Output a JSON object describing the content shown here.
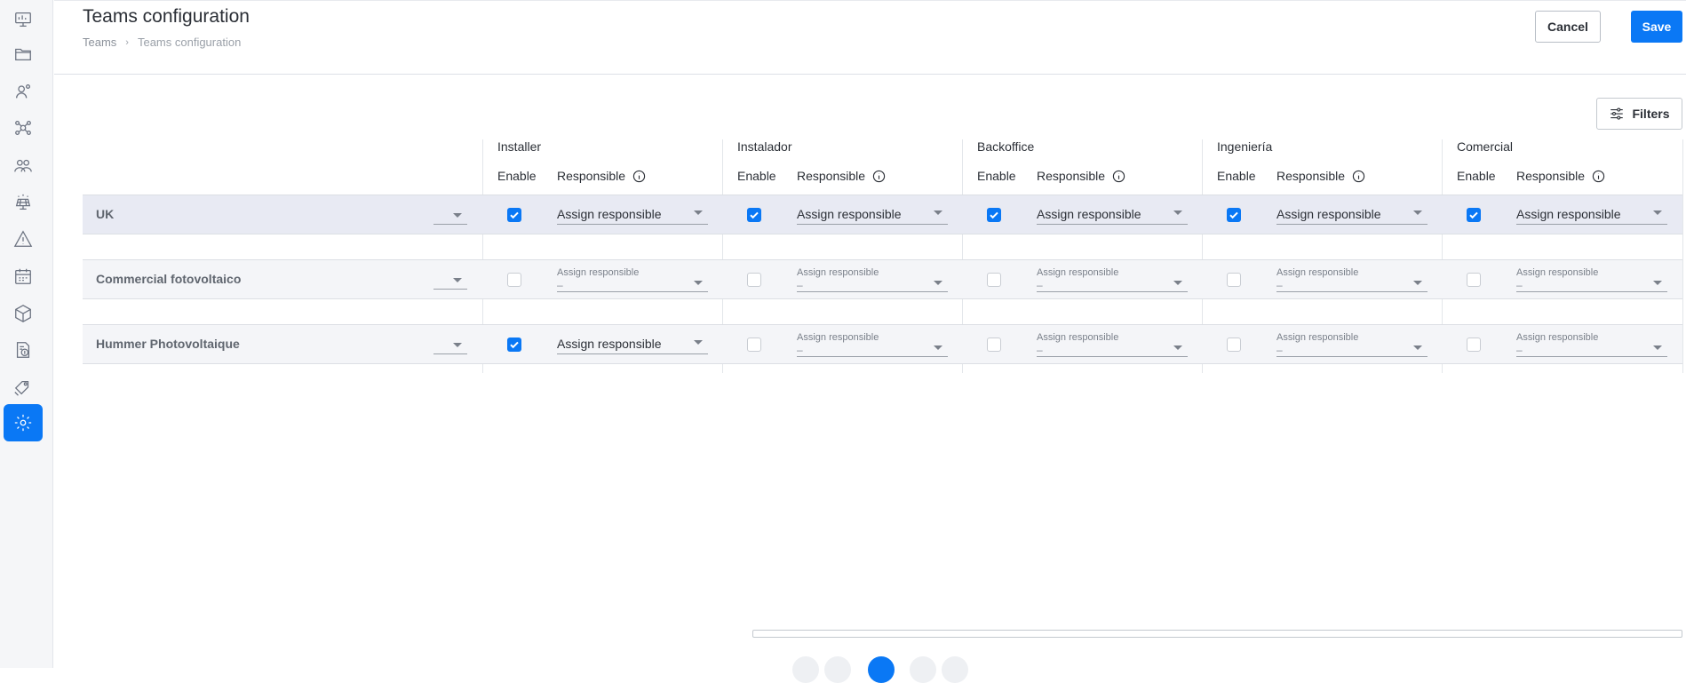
{
  "sidebar": {
    "items": [
      {
        "icon": "monitor-dashboard-icon",
        "active": false
      },
      {
        "icon": "folder-icon",
        "active": false
      },
      {
        "icon": "user-connect-icon",
        "active": false
      },
      {
        "icon": "team-network-icon",
        "active": false
      },
      {
        "icon": "users-group-icon",
        "active": false
      },
      {
        "icon": "solar-panel-icon",
        "active": false
      },
      {
        "icon": "warning-triangle-icon",
        "active": false
      },
      {
        "icon": "calendar-icon",
        "active": false
      },
      {
        "icon": "box-icon",
        "active": false
      },
      {
        "icon": "invoice-dollar-icon",
        "active": false
      },
      {
        "icon": "tag-discount-icon",
        "active": false
      },
      {
        "icon": "settings-gear-icon",
        "active": true
      }
    ]
  },
  "header": {
    "title": "Teams configuration",
    "breadcrumb": {
      "root": "Teams",
      "separator": "›",
      "current": "Teams configuration"
    },
    "cancel_label": "Cancel",
    "save_label": "Save"
  },
  "toolbar": {
    "filters_label": "Filters"
  },
  "columns": {
    "enable_label": "Enable",
    "responsible_label": "Responsible",
    "groups": [
      "Installer",
      "Instalador",
      "Backoffice",
      "Ingeniería",
      "Comercial"
    ]
  },
  "rows": [
    {
      "name": "UK",
      "cells": [
        {
          "enabled": true,
          "value": "Assign responsible"
        },
        {
          "enabled": true,
          "value": "Assign responsible"
        },
        {
          "enabled": true,
          "value": "Assign responsible"
        },
        {
          "enabled": true,
          "value": "Assign responsible"
        },
        {
          "enabled": true,
          "value": "Assign responsible"
        }
      ]
    },
    {
      "name": "Commercial fotovoltaico",
      "cells": [
        {
          "enabled": false,
          "placeholder": "Assign responsible",
          "value": "–"
        },
        {
          "enabled": false,
          "placeholder": "Assign responsible",
          "value": "–"
        },
        {
          "enabled": false,
          "placeholder": "Assign responsible",
          "value": "–"
        },
        {
          "enabled": false,
          "placeholder": "Assign responsible",
          "value": "–"
        },
        {
          "enabled": false,
          "placeholder": "Assign responsible",
          "value": "–"
        }
      ]
    },
    {
      "name": "Hummer Photovoltaique",
      "cells": [
        {
          "enabled": true,
          "value": "Assign responsible"
        },
        {
          "enabled": false,
          "placeholder": "Assign responsible",
          "value": "–"
        },
        {
          "enabled": false,
          "placeholder": "Assign responsible",
          "value": "–"
        },
        {
          "enabled": false,
          "placeholder": "Assign responsible",
          "value": "–"
        },
        {
          "enabled": false,
          "placeholder": "Assign responsible",
          "value": "–"
        }
      ]
    }
  ],
  "colors": {
    "accent": "#0a78f5",
    "row_highlight": "#e8eaf3",
    "row_band": "#f4f5f8"
  }
}
